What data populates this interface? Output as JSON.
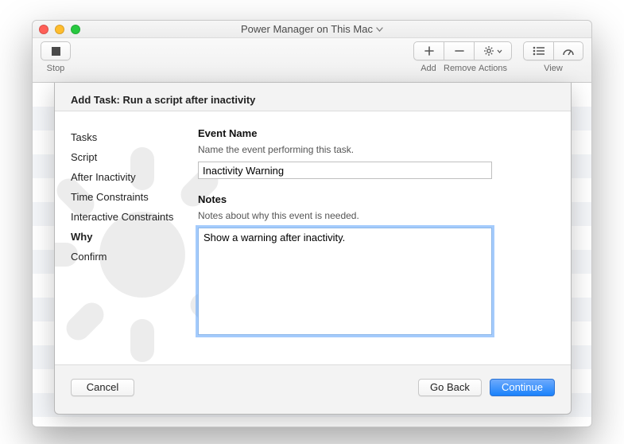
{
  "window": {
    "title": "Power Manager on This Mac"
  },
  "toolbar": {
    "stop_label": "Stop",
    "add_label": "Add",
    "remove_label": "Remove",
    "actions_label": "Actions",
    "view_label": "View"
  },
  "sheet": {
    "header_prefix": "Add Task:",
    "header_task": "Run a script after inactivity",
    "steps": [
      "Tasks",
      "Script",
      "After Inactivity",
      "Time Constraints",
      "Interactive Constraints",
      "Why",
      "Confirm"
    ],
    "active_step_index": 5,
    "event_name": {
      "label": "Event Name",
      "desc": "Name the event performing this task.",
      "value": "Inactivity Warning"
    },
    "notes": {
      "label": "Notes",
      "desc": "Notes about why this event is needed.",
      "value": "Show a warning after inactivity."
    },
    "buttons": {
      "cancel": "Cancel",
      "back": "Go Back",
      "continue": "Continue"
    }
  }
}
